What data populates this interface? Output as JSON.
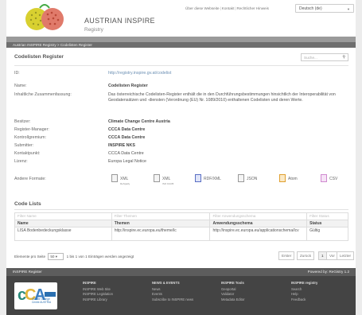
{
  "header": {
    "site_title": "AUSTRIAN INSPIRE",
    "site_subtitle": "Registry",
    "top_links": [
      "Über diese Webseite",
      "Kontakt",
      "Rechtlicher Hinweis"
    ],
    "language": "Deutsch (de)"
  },
  "breadcrumb": "Austrian INSPIRE Registry > Codelisten Register",
  "register": {
    "title": "Codelisten Register",
    "search_placeholder": "Suche...",
    "fields": [
      {
        "label": "ID:",
        "value": "http://registry.inspire.gv.at/codelist"
      },
      {
        "label": "Name:",
        "value": "Codelisten Register"
      },
      {
        "label": "Inhaltliche Zusammenfassung:",
        "value": "Das österreichische Codelisten-Register enthält die in den Durchführungsbestimmungen hinsichtlich der Interoperabilität von Geodatensätzen und -diensten (Verordnung (EU) Nr. 1089/2010) enthaltenen Codelisten und deren Werte."
      },
      {
        "label": "Besitzer:",
        "value": "Climate Change Centre Austria"
      },
      {
        "label": "Register-Manager:",
        "value": "CCCA Data Centre"
      },
      {
        "label": "Kontrollgremium:",
        "value": "CCCA Data Centre"
      },
      {
        "label": "Submitter:",
        "value": "INSPIRE NKS"
      },
      {
        "label": "Kontaktpunkt:",
        "value": "CCCA Data Centre"
      },
      {
        "label": "Lizenz:",
        "value": "Europa Legal Notice"
      }
    ],
    "formats_label": "Andere Formate:",
    "formats": [
      {
        "label": "XML",
        "sub": "ReSpatly"
      },
      {
        "label": "XML",
        "sub": "ISO 19135"
      },
      {
        "label": "RDF/XML",
        "sub": ""
      },
      {
        "label": "JSON",
        "sub": ""
      },
      {
        "label": "Atom",
        "sub": ""
      },
      {
        "label": "CSV",
        "sub": ""
      }
    ]
  },
  "code_lists": {
    "title": "Code Lists",
    "filters": [
      "Filter Name",
      "Filter Themen",
      "Filter Anwendungsschema",
      "Filter Status"
    ],
    "headers": [
      "Name",
      "Themen",
      "Anwendungsschema",
      "Status"
    ],
    "rows": [
      [
        "LISA Bodenbedeckungsklasse",
        "http://inspire.ec.europa.eu/theme/lc",
        "http://inspire.ec.europa.eu/applicationschema/lcv",
        "Gültig"
      ]
    ],
    "per_page_label": "Elemente pro Seite",
    "per_page": "50",
    "summary": "1 bis 1 von 1 Einträgen werden angezeigt",
    "pager": [
      "Erster",
      "Zurück",
      "1",
      "Vor",
      "Letzter"
    ]
  },
  "footer": {
    "left": "INSPIRE Register",
    "right": "Powered by: ReGistry 1.2",
    "columns": [
      {
        "title": "INSPIRE",
        "items": [
          "INSPIRE Web Site",
          "INSPIRE Legislation",
          "INSPIRE Library"
        ]
      },
      {
        "title": "NEWS & EVENTS",
        "items": [
          "News",
          "Events",
          "Subscribe to INSPIRE news"
        ]
      },
      {
        "title": "INSPIRE Tools",
        "items": [
          "Geoportal",
          "Validator",
          "Metadata Editor"
        ]
      },
      {
        "title": "INSPIRE registry",
        "items": [
          "Search",
          "Help",
          "Feedback"
        ]
      }
    ],
    "logo_text": "Climate Change Centre AUSTRIA"
  }
}
